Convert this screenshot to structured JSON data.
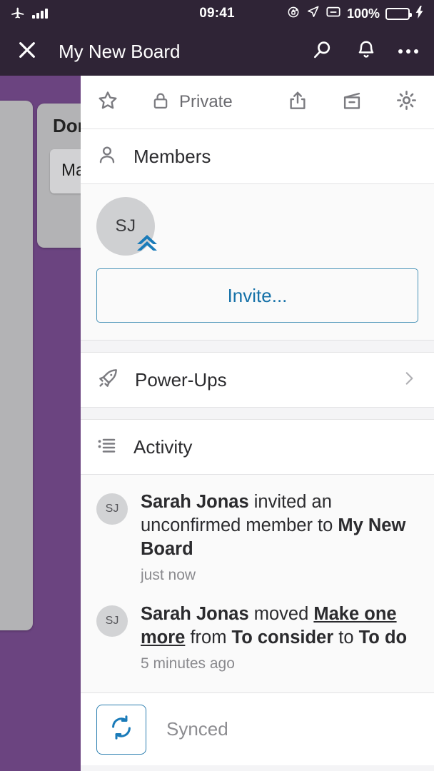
{
  "status_bar": {
    "airplane_icon": "airplane-mode-icon",
    "signal_icon": "signal-bars-icon",
    "time": "09:41",
    "rotation_lock_icon": "rotation-lock-icon",
    "location_icon": "location-arrow-icon",
    "screencast_icon": "screencast-icon",
    "battery_percent": "100%",
    "battery_icon": "battery-charging-icon",
    "charging_icon": "lightning-bolt-icon",
    "bg_color": "#2f2436"
  },
  "nav_bar": {
    "close_icon": "close-icon",
    "title": "My New Board",
    "search_icon": "search-icon",
    "notifications_icon": "bell-icon",
    "overflow_icon": "more-horizontal-icon"
  },
  "board_background": {
    "bg_color": "#6b4480",
    "lists": [
      {
        "title": "",
        "cards": [
          ""
        ]
      },
      {
        "title": "Don",
        "cards": [
          "Mak"
        ]
      }
    ]
  },
  "panel": {
    "toolbar": {
      "star_icon": "star-icon",
      "lock_icon": "lock-icon",
      "visibility_label": "Private",
      "share_icon": "share-icon",
      "archive_icon": "archive-icon",
      "settings_icon": "gear-icon"
    },
    "members": {
      "icon": "person-icon",
      "title": "Members",
      "avatars": [
        {
          "initials": "SJ",
          "badge_icon": "admin-double-chevron-icon"
        }
      ],
      "invite_label": "Invite...",
      "invite_color": "#1571a8"
    },
    "power_ups": {
      "icon": "rocket-icon",
      "title": "Power-Ups",
      "chevron_icon": "chevron-right-icon"
    },
    "activity": {
      "icon": "activity-list-icon",
      "title": "Activity",
      "items": [
        {
          "avatar_initials": "SJ",
          "actor": "Sarah Jonas",
          "verb": " invited an unconfirmed member to ",
          "target": "My New Board",
          "target_style": "bold",
          "time": "just now"
        },
        {
          "avatar_initials": "SJ",
          "actor": "Sarah Jonas",
          "verb": " moved ",
          "card": "Make one more",
          "mid": " from ",
          "from_list": "To consider",
          "joiner": " to ",
          "to_list": "To do",
          "time": "5 minutes ago"
        }
      ]
    },
    "sync": {
      "icon": "sync-refresh-icon",
      "label": "Synced",
      "icon_color": "#1a7bb9"
    }
  }
}
